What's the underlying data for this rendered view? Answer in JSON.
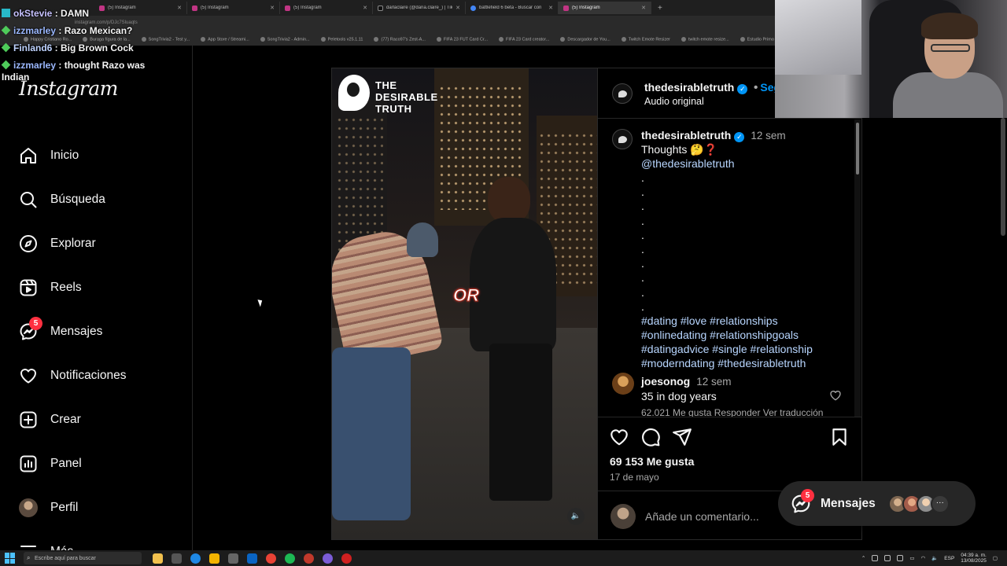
{
  "browser": {
    "tabs": [
      {
        "label": "(5) Instagram"
      },
      {
        "label": "(5) Instagram"
      },
      {
        "label": "(5) Instagram"
      },
      {
        "label": "darlaclaire (@daria.claire_) | Tik"
      },
      {
        "label": "battlefield 6 beta - Buscar con"
      },
      {
        "label": "(5) Instagram"
      }
    ],
    "address": "instagram.com/p/DJc7Sluaqts",
    "bookmarks": [
      "Happy Cristiano Ro...",
      "Buraga fígura de la...",
      "SongTrivia2 - Test y...",
      "App Store / Streami...",
      "SongTrivia2 - Admin...",
      "Peletools v25.1.11",
      "(77) Raco97's Zest-A...",
      "FIFA 23 FUT Card Cr...",
      "FIFA 23 Card creator...",
      "Descargador de You...",
      "Twitch Emote Resizer",
      "twitch emote resize...",
      "Estudio Primo"
    ]
  },
  "chat": [
    {
      "user": "okStevie",
      "message": " : DAMN"
    },
    {
      "user": "izzmarley",
      "message": " : Razo Mexican?"
    },
    {
      "user": "Finland6",
      "message": " : Big Brown Cock"
    },
    {
      "user": "izzmarley",
      "message": " : thought Razo was",
      "wrap": "Indian"
    }
  ],
  "sidebar": {
    "logo": "Instagram",
    "items": [
      {
        "label": "Inicio",
        "icon": "home-icon"
      },
      {
        "label": "Búsqueda",
        "icon": "search-icon"
      },
      {
        "label": "Explorar",
        "icon": "compass-icon"
      },
      {
        "label": "Reels",
        "icon": "reels-icon"
      },
      {
        "label": "Mensajes",
        "icon": "messenger-icon",
        "badge": "5"
      },
      {
        "label": "Notificaciones",
        "icon": "heart-icon"
      },
      {
        "label": "Crear",
        "icon": "plus-square-icon"
      },
      {
        "label": "Panel",
        "icon": "dashboard-icon"
      },
      {
        "label": "Perfil",
        "icon": "avatar"
      },
      {
        "label": "Más",
        "icon": "menu-icon"
      }
    ]
  },
  "post": {
    "media_brand": "THE\nDESIRABLE\nTRUTH",
    "media_overlay_text": "OR",
    "author": "thedesirabletruth",
    "follow_label": "Seg",
    "audio": "Audio original",
    "caption": {
      "author": "thedesirabletruth",
      "time": "12 sem",
      "text": "Thoughts 🤔❓",
      "mention": "@thedesirabletruth",
      "dots": [
        ".",
        ".",
        ".",
        ".",
        ".",
        ".",
        ".",
        ".",
        ".",
        "."
      ],
      "hashtags": [
        "#dating #love #relationships",
        "#onlinedating #relationshipgoals",
        "#datingadvice #single #relationship",
        "#moderndating #thedesirabletruth"
      ]
    },
    "comment": {
      "user": "joesonog",
      "time": "12 sem",
      "text": "35 in dog years",
      "meta": "62.021 Me gusta    Responder    Ver traducción"
    },
    "likes": "69 153 Me gusta",
    "date": "17 de mayo",
    "comment_placeholder": "Añade un comentario..."
  },
  "floating_messages": {
    "label": "Mensajes",
    "badge": "5",
    "more": "···"
  },
  "taskbar": {
    "search_placeholder": "Escribe aquí para buscar",
    "lang": "ESP",
    "time": "04:39 a. m.",
    "date": "13/08/2025"
  },
  "colors": {
    "accent": "#0095f6",
    "badge": "#ff3040",
    "link": "#b8d6ff"
  }
}
